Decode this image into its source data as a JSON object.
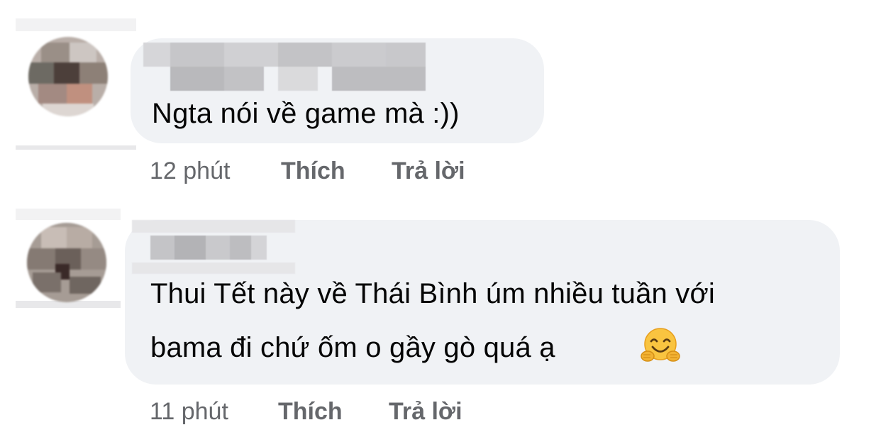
{
  "comments": [
    {
      "text_lines": [
        "Ngta nói về game mà :))"
      ],
      "time": "12 phút",
      "like_label": "Thích",
      "reply_label": "Trả lời",
      "avatar_icon": "pixelated-avatar"
    },
    {
      "text_lines": [
        "Thui Tết này về Thái Bình úm nhiều tuần với",
        "bama đi chứ ốm o gầy gò quá ạ"
      ],
      "emoji": "hugging-face-emoji",
      "time": "11 phút",
      "like_label": "Thích",
      "reply_label": "Trả lời",
      "avatar_icon": "pixelated-avatar"
    }
  ],
  "colors": {
    "bubble": "#f0f2f5",
    "meta_text": "#65676b",
    "body_text": "#050505"
  }
}
